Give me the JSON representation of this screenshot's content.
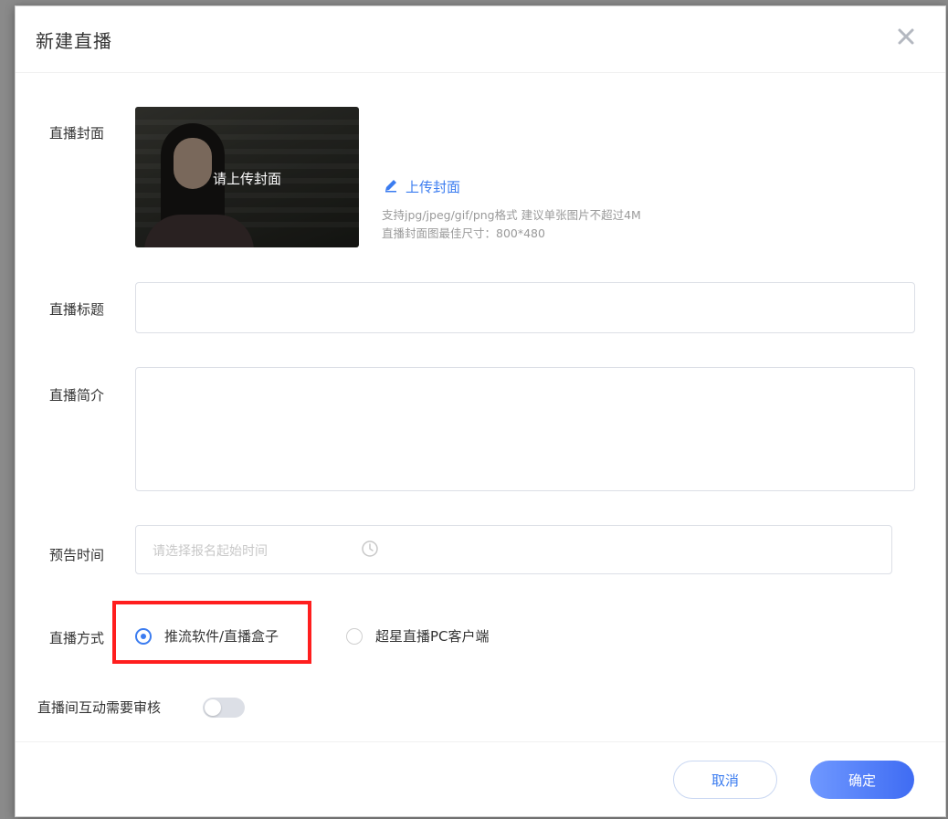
{
  "dialog": {
    "title": "新建直播"
  },
  "cover": {
    "label": "直播封面",
    "overlay_text": "请上传封面",
    "upload_link": "上传封面",
    "help_line1": "支持jpg/jpeg/gif/png格式 建议单张图片不超过4M",
    "help_line2": "直播封面图最佳尺寸：800*480"
  },
  "title_field": {
    "label": "直播标题",
    "value": ""
  },
  "intro_field": {
    "label": "直播简介",
    "value": ""
  },
  "time_field": {
    "label": "预告时间",
    "placeholder": "请选择报名起始时间"
  },
  "mode": {
    "label": "直播方式",
    "options": [
      {
        "label": "推流软件/直播盒子",
        "selected": true
      },
      {
        "label": "超星直播PC客户端",
        "selected": false
      }
    ]
  },
  "review": {
    "label": "直播间互动需要审核",
    "enabled": false
  },
  "footer": {
    "cancel": "取消",
    "ok": "确定"
  },
  "colors": {
    "accent": "#3b7cf0",
    "highlight": "#ff1e1e"
  },
  "icons": {
    "close": "close-icon",
    "edit": "pencil-icon",
    "time": "clock-icon"
  }
}
